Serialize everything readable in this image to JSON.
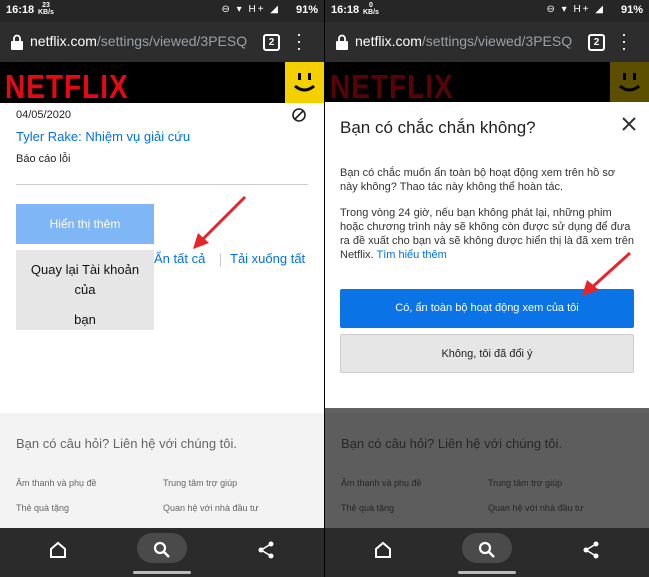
{
  "status": {
    "time": "16:18",
    "netspeed_top": "23",
    "netspeed_bottom": "KB/s",
    "netspeed_bottom_right": "0",
    "signal": "H+",
    "battery": "91%"
  },
  "browser": {
    "url_host": "netflix.com",
    "url_path": "/settings/viewed/3PESQ",
    "tab_count": "2"
  },
  "brand": {
    "logo": "NETFLIX",
    "color": "#e50914"
  },
  "left": {
    "date": "04/05/2020",
    "title": "Tyler Rake: Nhiệm vụ giải cứu",
    "report": "Báo cáo lỗi",
    "show_more": "Hiển thị thêm",
    "back_line1": "Quay lại Tài khoản của",
    "back_line2": "bạn",
    "hide_all": "Ẩn tất cả",
    "download_all": "Tải xuống tất"
  },
  "footer": {
    "question": "Bạn có câu hỏi? Liên hệ với chúng tôi.",
    "audio": "Âm thanh và phụ đề",
    "help": "Trung tâm trợ giúp",
    "gift": "Thẻ quà tặng",
    "investors": "Quan hệ với nhà đầu tư"
  },
  "dialog": {
    "title": "Bạn có chắc chắn không?",
    "p1": "Bạn có chắc muốn ẩn toàn bộ hoạt động xem trên hồ sơ này không? Thao tác này không thể hoàn tác.",
    "p2": "Trong vòng 24 giờ, nếu bạn không phát lại, những phim hoặc chương trình này sẽ không còn được sử dụng để đưa ra đề xuất cho bạn và sẽ không được hiển thị là đã xem trên Netflix.",
    "learn_more": "Tìm hiểu thêm",
    "confirm": "Có, ẩn toàn bộ hoạt động xem của tôi",
    "cancel": "Không, tôi đã đổi ý"
  },
  "icons": [
    "lock-icon",
    "tabs-icon",
    "menu-icon",
    "avatar-smiley-icon",
    "no-entry-icon",
    "close-icon",
    "home-icon",
    "search-icon",
    "share-icon",
    "arrow-annotation"
  ]
}
